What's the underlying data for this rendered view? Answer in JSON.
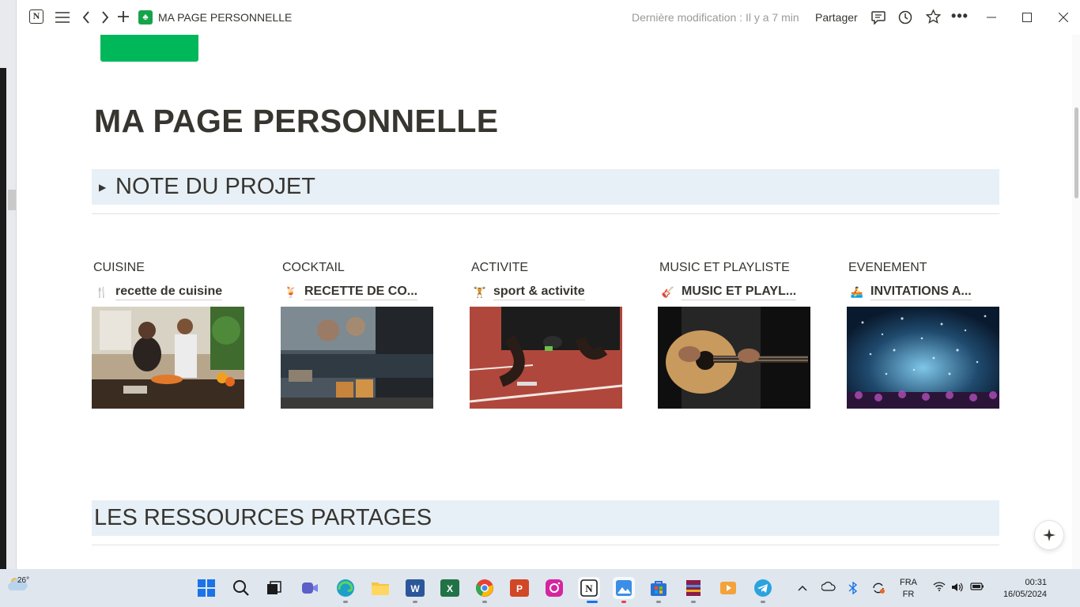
{
  "titlebar": {
    "page_name": "MA PAGE PERSONNELLE",
    "last_modified": "Dernière modification : Il y a 7 min",
    "share_label": "Partager"
  },
  "page": {
    "title": "MA PAGE PERSONNELLE",
    "toggle_heading": "NOTE DU PROJET",
    "section_heading": "LES RESSOURCES PARTAGES"
  },
  "columns": [
    {
      "label": "CUISINE",
      "link": "recette de cuisine",
      "icon": "fork-knife-icon"
    },
    {
      "label": "COCKTAIL",
      "link": "RECETTE DE CO...",
      "icon": "cocktail-icon"
    },
    {
      "label": "ACTIVITE",
      "link": "sport & activite",
      "icon": "weightlifter-icon"
    },
    {
      "label": "MUSIC ET PLAYLISTE",
      "link": "MUSIC ET PLAYL...",
      "icon": "music-icon"
    },
    {
      "label": "EVENEMENT",
      "link": "INVITATIONS A...",
      "icon": "rowing-icon"
    }
  ],
  "taskbar": {
    "weather_temp": "26°",
    "lang_1": "FRA",
    "lang_2": "FR",
    "time": "00:31",
    "date": "16/05/2024"
  },
  "colors": {
    "accent_green": "#00b75a",
    "header_bg": "#e7f0f7",
    "text": "#37352f"
  }
}
